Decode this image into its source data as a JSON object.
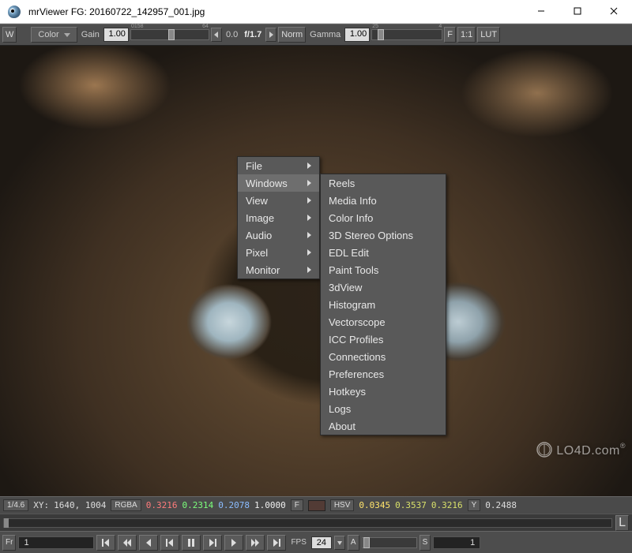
{
  "window": {
    "app_name": "mrViewer",
    "title_sep": "     ",
    "file_label": "FG: 20160722_142957_001.jpg"
  },
  "toolbar": {
    "w_btn": "W",
    "color_label": "Color",
    "gain_label": "Gain",
    "gain_value": "1.00",
    "gain_tick_a": "0158",
    "gain_tick_b": "64",
    "fstop_value": "0.0",
    "fstop_label": "f/1.7",
    "norm_btn": "Norm",
    "gamma_label": "Gamma",
    "gamma_value": "1.00",
    "gamma_tick_a": "25",
    "gamma_tick_b": "4",
    "f_btn": "F",
    "ratio_btn": "1:1",
    "lut_btn": "LUT"
  },
  "menu": {
    "items": [
      "File",
      "Windows",
      "View",
      "Image",
      "Audio",
      "Pixel",
      "Monitor"
    ],
    "active_index": 1,
    "submenu": [
      "Reels",
      "Media Info",
      "Color Info",
      "3D Stereo Options",
      "EDL Edit",
      "Paint Tools",
      "3dView",
      "Histogram",
      "Vectorscope",
      "ICC Profiles",
      "Connections",
      "Preferences",
      "Hotkeys",
      "Logs",
      "About"
    ]
  },
  "status": {
    "zoom": "1/4.6",
    "xy_label": "XY:",
    "xy": "1640, 1004",
    "rgba_label": "RGBA",
    "r": "0.3216",
    "g": "0.2314",
    "b": "0.2078",
    "a": "1.0000",
    "f_btn": "F",
    "swatch_hex": "#523b35",
    "hsv_label": "HSV",
    "h": "0.0345",
    "s": "0.3537",
    "v": "0.3216",
    "y_label": "Y",
    "y": "0.2488"
  },
  "timeline": {
    "l_btn": "L"
  },
  "transport": {
    "fr_label": "Fr",
    "frame": "1",
    "fps_label": "FPS",
    "fps": "24",
    "a_btn": "A",
    "s_btn": "S",
    "end": "1"
  },
  "watermark": "LO4D.com"
}
